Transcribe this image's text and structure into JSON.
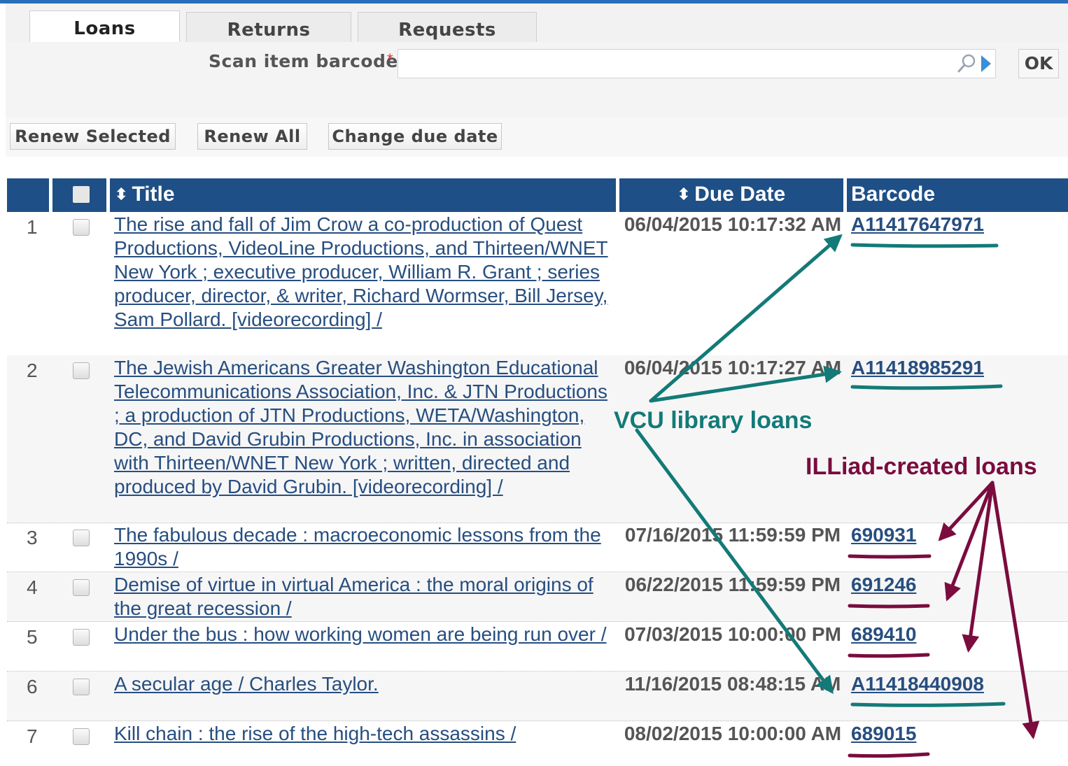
{
  "tabs": {
    "loans": "Loans",
    "returns": "Returns",
    "requests": "Requests"
  },
  "scan": {
    "label": "Scan item barcode",
    "required_mark": "*",
    "value": "",
    "ok_label": "OK"
  },
  "actions": {
    "renew_selected": "Renew Selected",
    "renew_all": "Renew All",
    "change_due_date": "Change due date"
  },
  "table": {
    "columns": {
      "title": "Title",
      "due_date": "Due Date",
      "barcode": "Barcode"
    },
    "sort_glyph": "⬍",
    "rows": [
      {
        "num": "1",
        "title": "The rise and fall of Jim Crow a co-production of Quest Productions, VideoLine Productions, and Thirteen/WNET New York ; executive producer, William R. Grant ; series producer, director, & writer, Richard Wormser, Bill Jersey, Sam Pollard. [videorecording] /",
        "due_date": "06/04/2015 10:17:32 AM",
        "barcode": "A11417647971"
      },
      {
        "num": "2",
        "title": "The Jewish Americans Greater Washington Educational Telecommunications Association, Inc. & JTN Productions ; a production of JTN Productions, WETA/Washington, DC, and David Grubin Productions, Inc. in association with Thirteen/WNET New York ; written, directed and produced by David Grubin. [videorecording] /",
        "due_date": "06/04/2015 10:17:27 AM",
        "barcode": "A11418985291"
      },
      {
        "num": "3",
        "title": "The fabulous decade : macroeconomic lessons from the 1990s /",
        "due_date": "07/16/2015 11:59:59 PM",
        "barcode": "690931"
      },
      {
        "num": "4",
        "title": "Demise of virtue in virtual America : the moral origins of the great recession /",
        "due_date": "06/22/2015 11:59:59 PM",
        "barcode": "691246"
      },
      {
        "num": "5",
        "title": "Under the bus : how working women are being run over /",
        "due_date": "07/03/2015 10:00:00 PM",
        "barcode": "689410"
      },
      {
        "num": "6",
        "title": "A secular age / Charles Taylor.",
        "due_date": "11/16/2015 08:48:15 AM",
        "barcode": "A11418440908"
      },
      {
        "num": "7",
        "title": "Kill chain : the rise of the high-tech assassins /",
        "due_date": "08/02/2015 10:00:00 AM",
        "barcode": "689015"
      }
    ]
  },
  "annotations": {
    "vcu_label": "VCU library loans",
    "illiad_label": "ILLiad-created loans",
    "vcu_color": "#137a78",
    "illiad_color": "#7a0c3e"
  },
  "colors": {
    "header_bg": "#1e4f86",
    "link": "#274e80",
    "topbar": "#2a6ebb"
  }
}
